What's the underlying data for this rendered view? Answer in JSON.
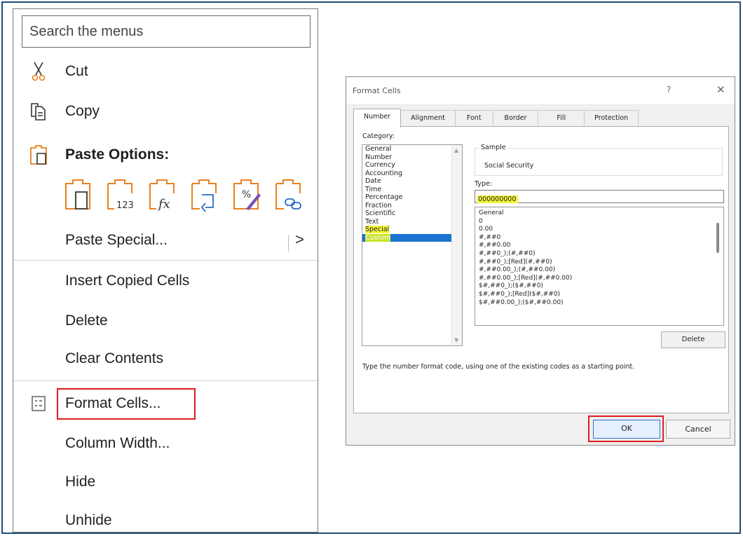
{
  "context_menu": {
    "search_placeholder": "Search the menus",
    "items": {
      "cut": "Cut",
      "copy": "Copy",
      "paste_options": "Paste Options:",
      "paste_special": "Paste Special...",
      "insert_copied_cells": "Insert Copied Cells",
      "delete": "Delete",
      "clear_contents": "Clear Contents",
      "format_cells": "Format Cells...",
      "column_width": "Column Width...",
      "hide": "Hide",
      "unhide": "Unhide"
    },
    "submenu_arrow": ">",
    "paste_option_icons": [
      "paste-icon",
      "paste-values-icon",
      "paste-formulas-icon",
      "paste-transpose-icon",
      "paste-formatting-icon",
      "paste-link-icon"
    ]
  },
  "dialog": {
    "title": "Format Cells",
    "help": "?",
    "close": "✕",
    "tabs": [
      "Number",
      "Alignment",
      "Font",
      "Border",
      "Fill",
      "Protection"
    ],
    "active_tab": "Number",
    "category_label": "Category:",
    "categories": [
      "General",
      "Number",
      "Currency",
      "Accounting",
      "Date",
      "Time",
      "Percentage",
      "Fraction",
      "Scientific",
      "Text",
      "Special",
      "Custom"
    ],
    "selected_category": "Custom",
    "sample_label": "Sample",
    "sample_value": "Social Security",
    "type_label": "Type:",
    "type_value": "000000000",
    "format_codes": [
      "General",
      "0",
      "0.00",
      "#,##0",
      "#,##0.00",
      "#,##0_);(#,##0)",
      "#,##0_);[Red](#,##0)",
      "#,##0.00_);(#,##0.00)",
      "#,##0.00_);[Red](#,##0.00)",
      "$#,##0_);($#,##0)",
      "$#,##0_);[Red]($#,##0)",
      "$#,##0.00_);($#,##0.00)"
    ],
    "delete_button": "Delete",
    "hint": "Type the number format code, using one of the existing codes as a starting point.",
    "ok_button": "OK",
    "cancel_button": "Cancel"
  },
  "colors": {
    "accent_orange": "#e8811f",
    "highlight_red": "#e01e1e",
    "selection_blue": "#1a73d1",
    "marker_yellow": "#f4f33a",
    "frame_blue": "#1f4e79"
  }
}
